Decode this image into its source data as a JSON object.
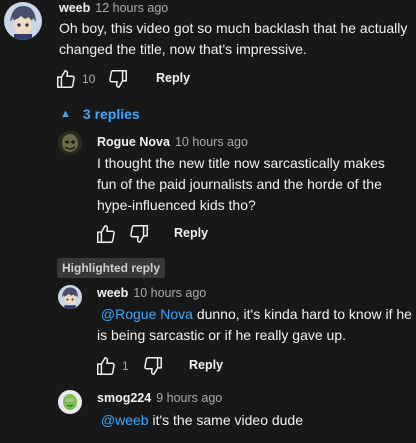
{
  "comment": {
    "author": "weeb",
    "time": "12 hours ago",
    "text": "Oh boy, this video got so much backlash that he actually changed the title, now that's impressive.",
    "likes": "10",
    "reply_label": "Reply"
  },
  "replies_toggle": {
    "label": "3 replies"
  },
  "replies": [
    {
      "author": "Rogue Nova",
      "time": "10 hours ago",
      "text": "I thought the new title now sarcastically makes fun of the paid journalists and the horde of the hype-influenced kids tho?",
      "likes": "",
      "reply_label": "Reply"
    },
    {
      "highlight_label": "Highlighted reply",
      "author": "weeb",
      "time": "10 hours ago",
      "mention": "@Rogue Nova",
      "text": " dunno, it's kinda hard to know if he is being sarcastic or if he really gave up.",
      "likes": "1",
      "reply_label": "Reply"
    },
    {
      "author": "smog224",
      "time": "9 hours ago",
      "mention": "@weeb",
      "text": " it's the same video dude"
    }
  ],
  "colors": {
    "background": "#181818",
    "link": "#3ea6ff",
    "text": "#f1f1f1",
    "secondary_text": "#aaaaaa"
  }
}
